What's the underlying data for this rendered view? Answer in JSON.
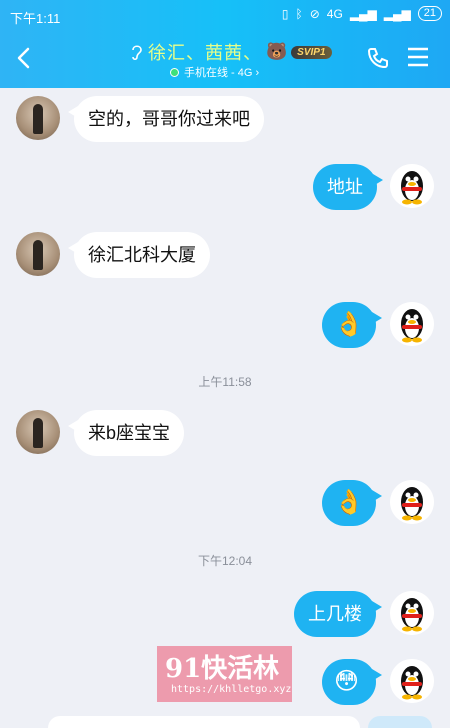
{
  "status_bar": {
    "time": "下午1:11",
    "network": "4G",
    "battery": "21"
  },
  "header": {
    "title": "徐汇、茜茜、",
    "bear_emoji": "🐻",
    "vip_badge": "SVIP1",
    "subtitle": "手机在线 - 4G ›",
    "online_color": "#3fe07a",
    "accent": "#1fb3f2"
  },
  "messages": [
    {
      "side": "in",
      "text": "空的，哥哥你过来吧"
    },
    {
      "side": "out",
      "text": "地址"
    },
    {
      "side": "in",
      "text": "徐汇北科大厦"
    },
    {
      "side": "out",
      "text": "👌"
    },
    {
      "timestamp": "上午11:58"
    },
    {
      "side": "in",
      "text": "来b座宝宝"
    },
    {
      "side": "out",
      "text": "👌"
    },
    {
      "timestamp": "下午12:04"
    },
    {
      "side": "out",
      "text": "上几楼"
    },
    {
      "side": "out",
      "text": "😳"
    }
  ],
  "watermark": {
    "title": "91快活林",
    "url": "https://khlletgo.xyz"
  },
  "icons": [
    "back-arrow-icon",
    "ear-icon",
    "phone-icon",
    "menu-icon",
    "penguin-avatar-icon"
  ]
}
